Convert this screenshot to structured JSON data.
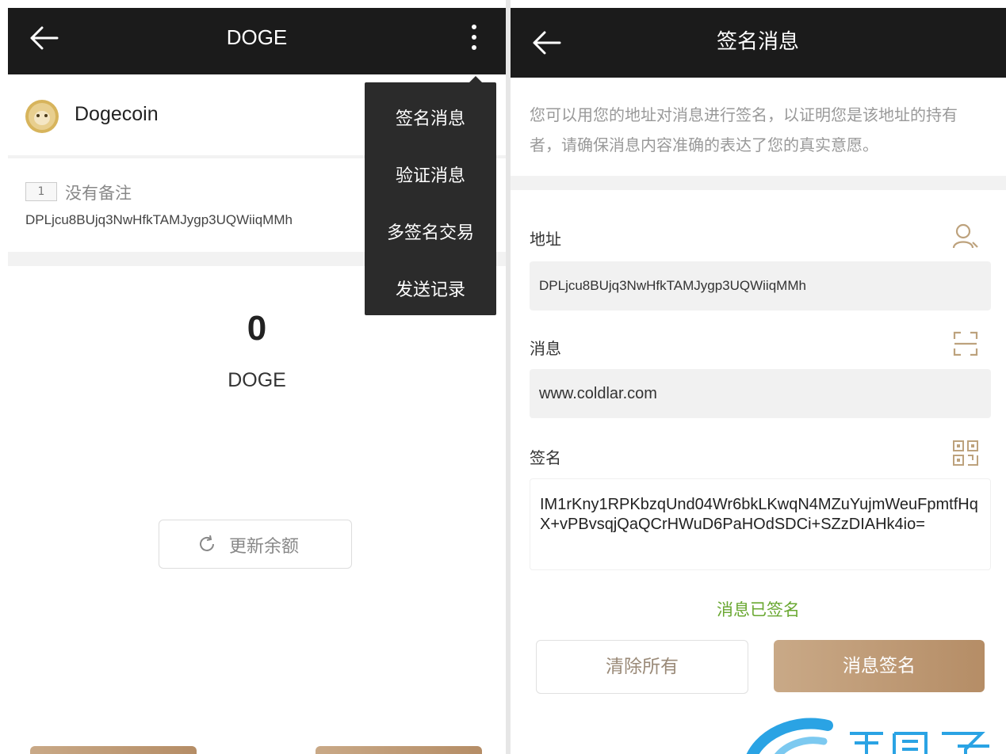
{
  "left": {
    "header": {
      "back_icon": "arrow-left-icon",
      "title": "DOGE",
      "more_icon": "more-vertical-icon"
    },
    "account": {
      "coin_icon": "dogecoin-icon",
      "name": "Dogecoin"
    },
    "address_card": {
      "tag_number": "1",
      "note": "没有备注",
      "address": "DPLjcu8BUjq3NwHfkTAMJygp3UQWiiqMMh"
    },
    "balance": {
      "amount": "0",
      "unit": "DOGE"
    },
    "refresh_button": {
      "icon": "refresh-icon",
      "label": "更新余额"
    },
    "menu": {
      "items": [
        "签名消息",
        "验证消息",
        "多签名交易",
        "发送记录"
      ]
    }
  },
  "right": {
    "header": {
      "back_icon": "arrow-left-icon",
      "title": "签名消息"
    },
    "description": "您可以用您的地址对消息进行签名，以证明您是该地址的持有者，请确保消息内容准确的表达了您的真实意愿。",
    "address": {
      "label": "地址",
      "value": "DPLjcu8BUjq3NwHfkTAMJygp3UQWiiqMMh",
      "icon": "user-icon"
    },
    "message": {
      "label": "消息",
      "value": "www.coldlar.com",
      "icon": "scan-icon"
    },
    "signature": {
      "label": "签名",
      "value": "IM1rKny1RPKbzqUnd04Wr6bkLKwqN4MZuYujmWeuFpmtfHqX+vPBvsqjQaQCrHWuD6PaHOdSDCi+SZzDIAHk4io=",
      "icon": "qr-code-icon"
    },
    "status": "消息已签名",
    "clear_button": "清除所有",
    "sign_button": "消息签名"
  },
  "colors": {
    "topbar": "#1b1b1b",
    "accent_gold": "#c4a07b",
    "status_green": "#6aa832",
    "menu_bg": "#2b2b2b"
  }
}
